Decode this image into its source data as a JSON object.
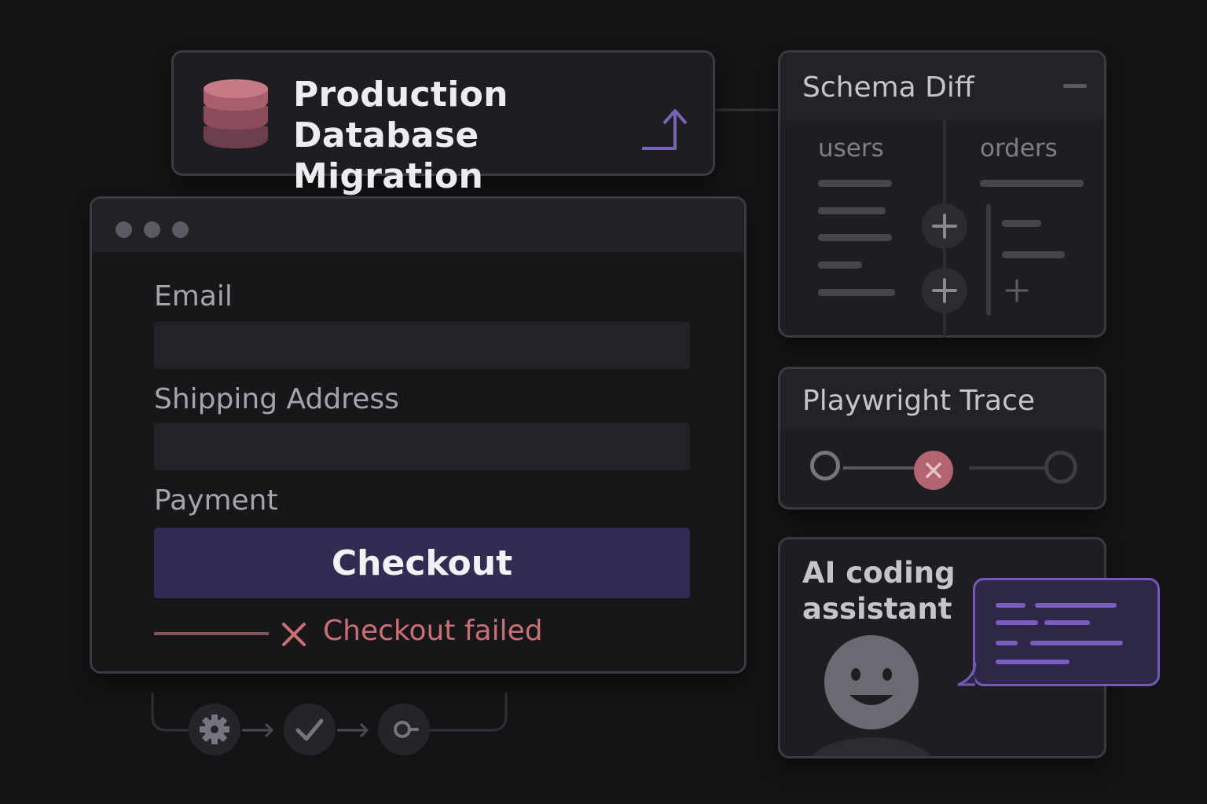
{
  "migration": {
    "title": "Production Database\nMigration",
    "icons": [
      "database-icon",
      "arrow-up-right-icon"
    ]
  },
  "form": {
    "email_label": "Email",
    "shipping_label": "Shipping Address",
    "payment_label": "Payment",
    "checkout_button": "Checkout",
    "error_text": "Checkout failed",
    "error_icon": "x-icon"
  },
  "schema_diff": {
    "title": "Schema Diff",
    "left_table": "users",
    "right_table": "orders",
    "collapse_icon": "minus-icon",
    "add_icon": "plus-icon"
  },
  "trace": {
    "title": "Playwright Trace",
    "steps": [
      "passed",
      "failed",
      "pending"
    ]
  },
  "assistant": {
    "title": "AI coding\nassistant",
    "avatar_icon": "smiley-face-icon",
    "bubble_icon": "chat-bubble-icon"
  },
  "pipeline": {
    "steps": [
      "gear-icon",
      "check-icon",
      "commit-icon"
    ]
  },
  "colors": {
    "background": "#141417",
    "accent_purple": "#7559b6",
    "button_purple": "#342b52",
    "error_red": "#c97076",
    "db_pink": "#b86c78"
  }
}
